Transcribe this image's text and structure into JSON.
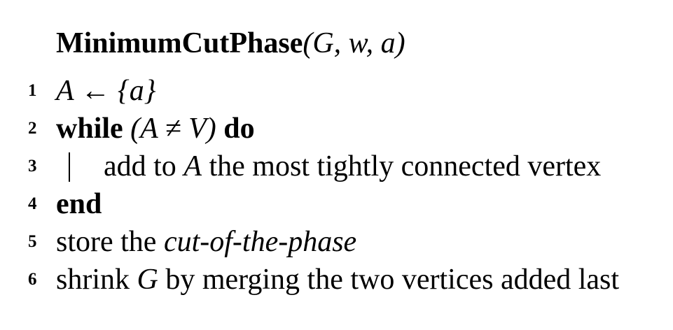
{
  "algorithm": {
    "title": {
      "name": "MinimumCutPhase",
      "params": "(G, w, a)"
    },
    "lines": [
      {
        "num": "1",
        "text": "A ← {a}"
      },
      {
        "num": "2",
        "kw_start": "while",
        "cond": " (A ≠ V) ",
        "kw_end": "do"
      },
      {
        "num": "3",
        "pre": "add to ",
        "var": "A",
        "post": " the most tightly connected vertex"
      },
      {
        "num": "4",
        "kw": "end"
      },
      {
        "num": "5",
        "pre": "store the ",
        "em": "cut-of-the-phase"
      },
      {
        "num": "6",
        "pre": "shrink ",
        "var": "G",
        "post": " by merging the two vertices added last"
      }
    ]
  }
}
